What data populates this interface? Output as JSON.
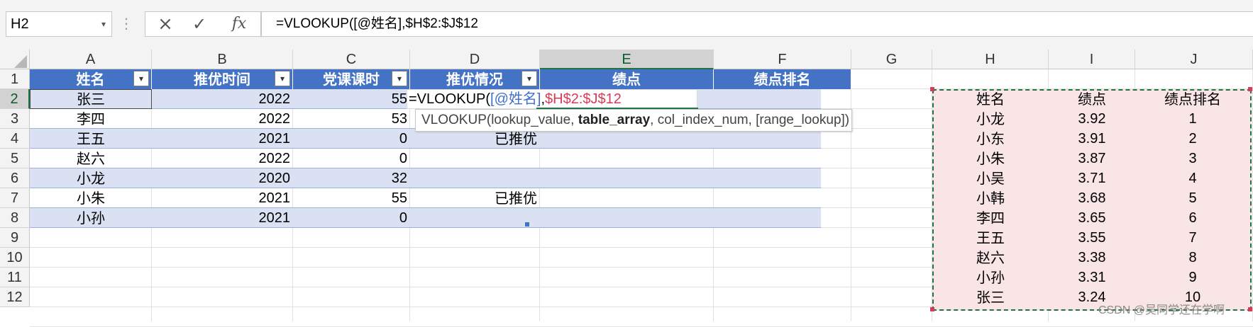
{
  "name_box": {
    "value": "H2"
  },
  "formula_bar": {
    "value": "=VLOOKUP([@姓名],$H$2:$J$12"
  },
  "icons": {
    "cancel": "×",
    "enter": "✓",
    "fx": "fx",
    "dropdown": "▾",
    "more": "⋮",
    "filter": "▾"
  },
  "columns": [
    "A",
    "B",
    "C",
    "D",
    "E",
    "F",
    "G",
    "H",
    "I",
    "J"
  ],
  "rows": [
    "1",
    "2",
    "3",
    "4",
    "5",
    "6",
    "7",
    "8",
    "9",
    "10",
    "11",
    "12"
  ],
  "table": {
    "headers": [
      "姓名",
      "推优时间",
      "党课课时",
      "推优情况",
      "绩点",
      "绩点排名"
    ],
    "rows": [
      {
        "name": "张三",
        "year": "2022",
        "hours": "55",
        "status": ""
      },
      {
        "name": "李四",
        "year": "2022",
        "hours": "53",
        "status": ""
      },
      {
        "name": "王五",
        "year": "2021",
        "hours": "0",
        "status": "已推优"
      },
      {
        "name": "赵六",
        "year": "2022",
        "hours": "0",
        "status": ""
      },
      {
        "name": "小龙",
        "year": "2020",
        "hours": "32",
        "status": ""
      },
      {
        "name": "小朱",
        "year": "2021",
        "hours": "55",
        "status": "已推优"
      },
      {
        "name": "小孙",
        "year": "2021",
        "hours": "0",
        "status": ""
      }
    ]
  },
  "editing": {
    "prefix": "=VLOOKUP(",
    "ref1": "[@姓名]",
    "sep": ",",
    "ref2": "$H$2:$J$12"
  },
  "tooltip": {
    "func": "VLOOKUP(",
    "arg1": "lookup_value, ",
    "arg2_bold": "table_array",
    "rest": ", col_index_num, [range_lookup])"
  },
  "lookup": {
    "headers": [
      "姓名",
      "绩点",
      "绩点排名"
    ],
    "rows": [
      {
        "name": "小龙",
        "gpa": "3.92",
        "rank": "1"
      },
      {
        "name": "小东",
        "gpa": "3.91",
        "rank": "2"
      },
      {
        "name": "小朱",
        "gpa": "3.87",
        "rank": "3"
      },
      {
        "name": "小吴",
        "gpa": "3.71",
        "rank": "4"
      },
      {
        "name": "小韩",
        "gpa": "3.68",
        "rank": "5"
      },
      {
        "name": "李四",
        "gpa": "3.65",
        "rank": "6"
      },
      {
        "name": "王五",
        "gpa": "3.55",
        "rank": "7"
      },
      {
        "name": "赵六",
        "gpa": "3.38",
        "rank": "8"
      },
      {
        "name": "小孙",
        "gpa": "3.31",
        "rank": "9"
      },
      {
        "name": "张三",
        "gpa": "3.24",
        "rank": "10"
      }
    ]
  },
  "watermark": "CSDN @吴同学还在学啊",
  "colors": {
    "header_blue": "#4472c4",
    "band": "#d9e1f2",
    "ref_blue": "#3f6fce",
    "ref_red": "#d83b57",
    "accent_green": "#217346"
  }
}
